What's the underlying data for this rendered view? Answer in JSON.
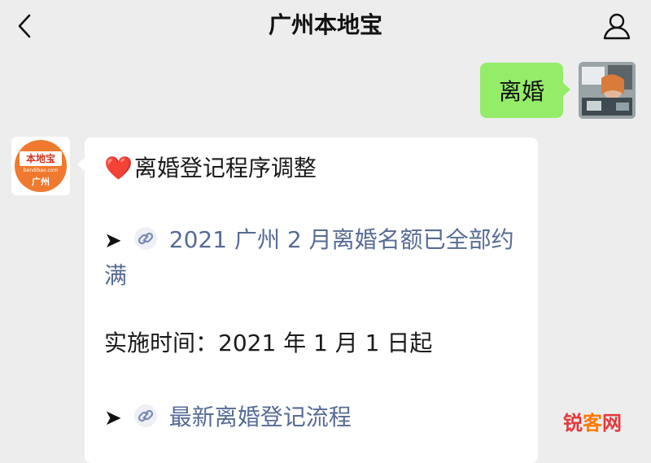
{
  "header": {
    "title": "广州本地宝",
    "back_icon": "chevron-left-icon",
    "profile_icon": "person-icon"
  },
  "messages": {
    "outgoing": {
      "text": "离婚",
      "bubble_color": "#95ec69"
    },
    "incoming": {
      "sender_avatar": {
        "brand": "本地宝",
        "sub": "bendibao.com",
        "city": "广州"
      },
      "heading": "离婚登记程序调整",
      "heart_icon": "heart-icon",
      "link1": {
        "arrow": "➤",
        "text_line1": "2021 广州 2 月离婚名额已全部约",
        "text_line2": "满"
      },
      "date_line": "实施时间：2021 年 1 月 1 日起",
      "link2": {
        "arrow": "➤",
        "text": "最新离婚登记流程"
      },
      "link_color": "#576b95"
    }
  },
  "watermark": {
    "part1": "锐",
    "part2": "客",
    "part3": "网"
  }
}
